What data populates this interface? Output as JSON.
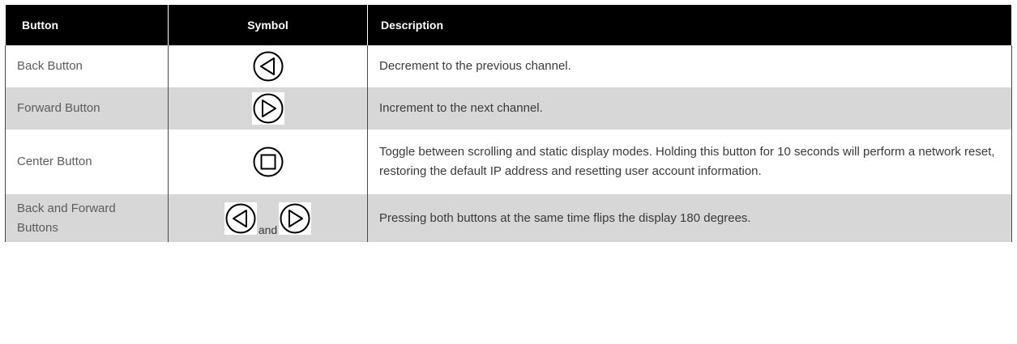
{
  "table": {
    "headers": {
      "button": "Button",
      "symbol": "Symbol",
      "description": "Description"
    },
    "rows": [
      {
        "button": "Back Button",
        "symbol_icons": [
          "back-triangle-icon"
        ],
        "description": "Decrement to the previous channel."
      },
      {
        "button": "Forward Button",
        "symbol_icons": [
          "forward-triangle-icon"
        ],
        "description": "Increment to the next channel."
      },
      {
        "button": "Center Button",
        "symbol_icons": [
          "center-square-icon"
        ],
        "description": "Toggle between scrolling and static display modes. Holding this button for 10 seconds will perform a network reset, restoring the default IP address and resetting user account information."
      },
      {
        "button": "Back and Forward Buttons",
        "symbol_icons": [
          "back-triangle-icon",
          "forward-triangle-icon"
        ],
        "symbol_joiner": "and",
        "description": "Pressing both buttons at the same time flips the display 180 degrees."
      }
    ]
  },
  "colors": {
    "header_bg": "#000000",
    "header_text": "#ffffff",
    "row_alt_bg": "#d7d7d7",
    "row_bg": "#ffffff"
  }
}
